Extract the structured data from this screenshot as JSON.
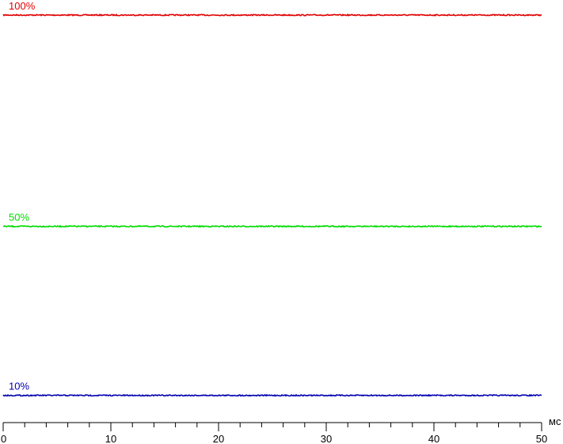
{
  "chart_data": {
    "type": "line",
    "x_unit": "мс",
    "x_ticks": [
      "0",
      "10",
      "20",
      "30",
      "40",
      "50"
    ],
    "xlim": [
      0,
      50
    ],
    "ylim": [
      0,
      100
    ],
    "grid": false,
    "series": [
      {
        "name": "100%",
        "color": "#e00000",
        "value": 100
      },
      {
        "name": "50%",
        "color": "#00dd00",
        "value": 50
      },
      {
        "name": "10%",
        "color": "#0000b0",
        "value": 10
      }
    ]
  }
}
